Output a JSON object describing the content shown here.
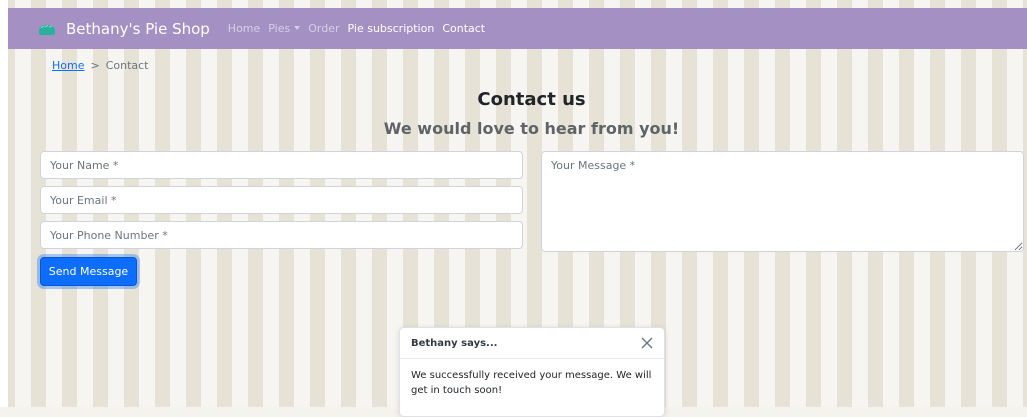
{
  "navbar": {
    "brand": "Bethany's Pie Shop",
    "links": [
      {
        "label": "Home"
      },
      {
        "label": "Pies"
      },
      {
        "label": "Order"
      },
      {
        "label": "Pie subscription"
      },
      {
        "label": "Contact"
      }
    ]
  },
  "breadcrumb": {
    "home": "Home",
    "separator": ">",
    "current": "Contact"
  },
  "page": {
    "title": "Contact us",
    "subtitle": "We would love to hear from you!"
  },
  "form": {
    "name_placeholder": "Your Name *",
    "email_placeholder": "Your Email *",
    "phone_placeholder": "Your Phone Number *",
    "message_placeholder": "Your Message *",
    "submit_label": "Send Message"
  },
  "toast": {
    "title": "Bethany says...",
    "message": "We successfully received your message. We will get in touch soon!"
  },
  "colors": {
    "navbar": "#a590c4",
    "primary": "#0d6efd",
    "stripe_dark": "#e6e3d6",
    "stripe_light": "#f7f5f1",
    "logo": "#2bb19b"
  }
}
